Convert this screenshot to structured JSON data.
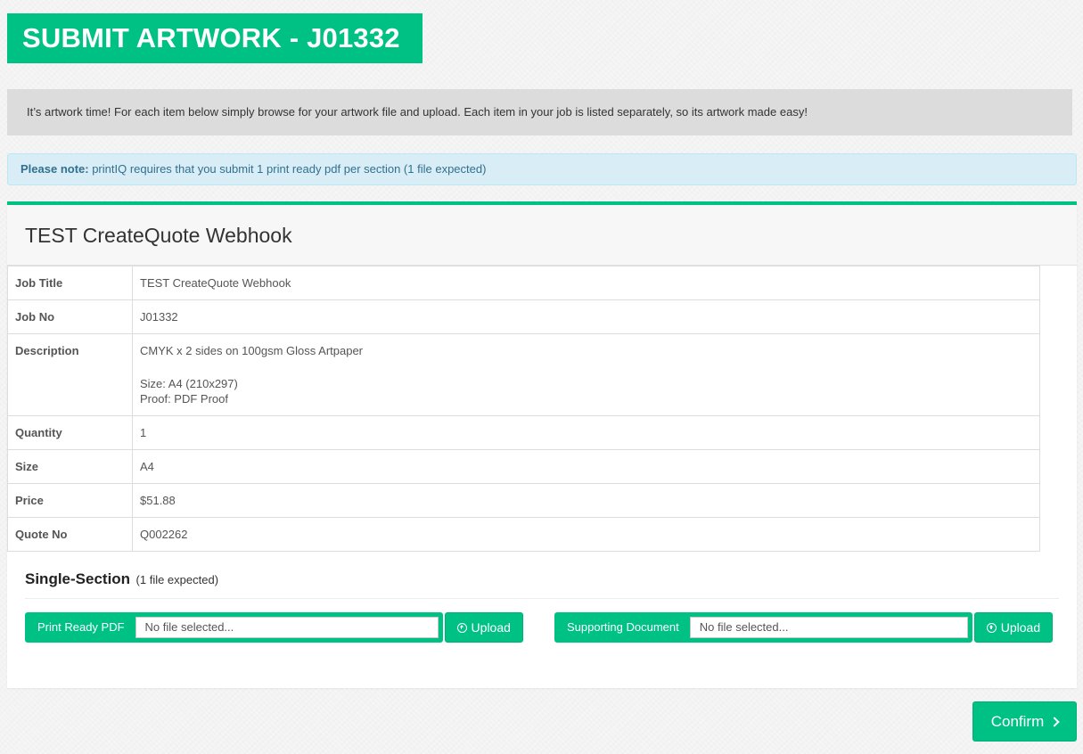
{
  "header": {
    "title": "SUBMIT ARTWORK - J01332"
  },
  "intro": {
    "text": "It’s artwork time! For each item below simply browse for your artwork file and upload. Each item in your job is listed separately, so its artwork made easy!"
  },
  "note": {
    "label": "Please note:",
    "text": " printIQ requires that you submit 1 print ready pdf per section (1 file expected)"
  },
  "panel": {
    "heading": "TEST CreateQuote Webhook"
  },
  "details": {
    "job_title": {
      "label": "Job Title",
      "value": "TEST CreateQuote Webhook"
    },
    "job_no": {
      "label": "Job No",
      "value": "J01332"
    },
    "description": {
      "label": "Description",
      "line1": "CMYK x 2 sides on 100gsm Gloss Artpaper",
      "line2": "Size: A4 (210x297)",
      "line3": "Proof: PDF Proof"
    },
    "quantity": {
      "label": "Quantity",
      "value": "1"
    },
    "size": {
      "label": "Size",
      "value": "A4"
    },
    "price": {
      "label": "Price",
      "value": "$51.88"
    },
    "quote_no": {
      "label": "Quote No",
      "value": "Q002262"
    }
  },
  "section": {
    "title": "Single-Section",
    "subtitle": "(1 file expected)",
    "print_ready": {
      "label": "Print Ready PDF",
      "placeholder": "No file selected...",
      "upload_label": "Upload"
    },
    "supporting": {
      "label": "Supporting Document",
      "placeholder": "No file selected...",
      "upload_label": "Upload"
    }
  },
  "footer": {
    "confirm_label": "Confirm"
  },
  "colors": {
    "accent": "#00c184",
    "info_bg": "#d9edf7",
    "info_text": "#31708f"
  }
}
